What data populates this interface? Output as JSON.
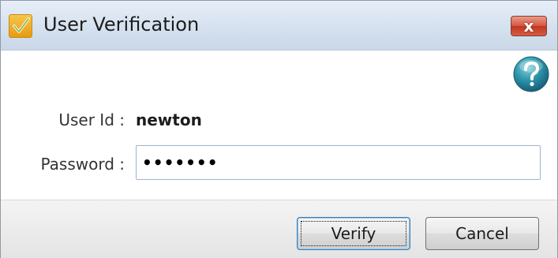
{
  "window": {
    "title": "User Verification",
    "close_symbol": "x",
    "app_icon": "checkmark-icon",
    "help_icon": "question-mark-icon"
  },
  "form": {
    "userid_label": "User Id :",
    "userid_value": "newton",
    "password_label": "Password :",
    "password_value": "•••••••"
  },
  "buttons": {
    "verify_label": "Verify",
    "cancel_label": "Cancel"
  },
  "colors": {
    "title_bar": "#d4e0ee",
    "close_button": "#c9452c",
    "help_icon": "#2c93a8",
    "app_icon": "#f0aa22"
  }
}
